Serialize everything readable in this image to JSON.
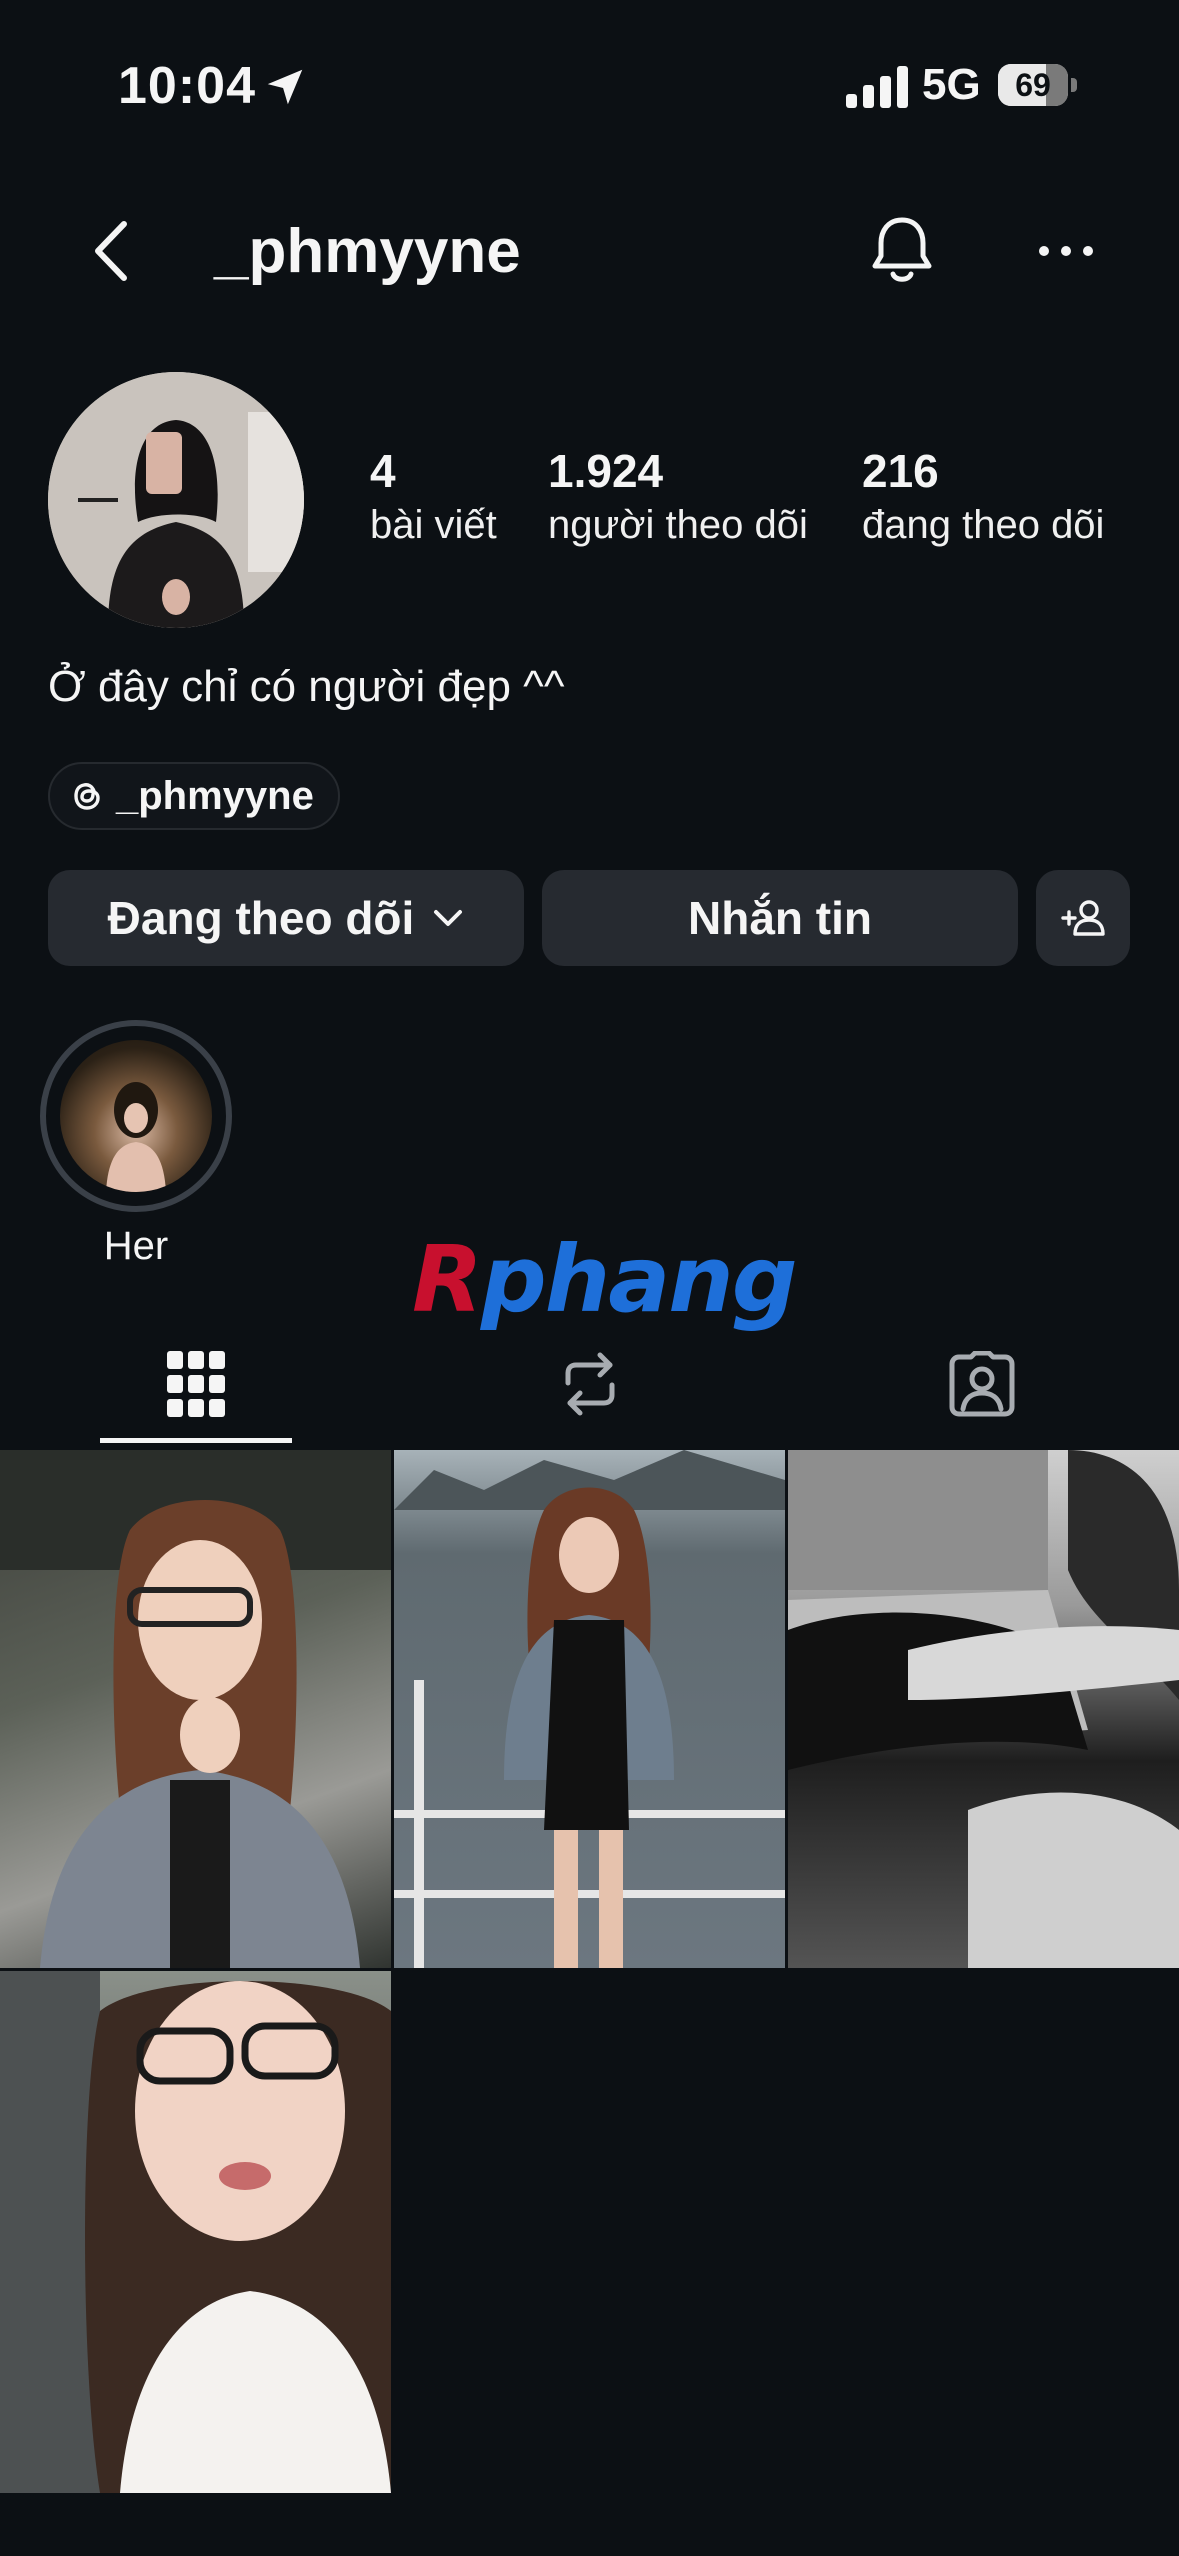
{
  "status_bar": {
    "time": "10:04",
    "network": "5G",
    "battery": "69",
    "battery_level": 0.69
  },
  "header": {
    "username": "_phmyyne"
  },
  "profile": {
    "stats": [
      {
        "value": "4",
        "label": "bài viết"
      },
      {
        "value": "1.924",
        "label": "người theo dõi"
      },
      {
        "value": "216",
        "label": "đang theo dõi"
      }
    ],
    "bio": "Ở đây chỉ có người đẹp ^^",
    "threads_handle": "_phmyyne"
  },
  "actions": {
    "following_label": "Đang theo dõi",
    "message_label": "Nhắn tin"
  },
  "highlights": [
    {
      "label": "Her"
    }
  ],
  "watermark": "Rphang",
  "tabs": [
    "grid-icon",
    "reposts-icon",
    "tagged-icon"
  ],
  "posts": [
    {
      "icon": "photo-woman-gray-jacket-icon"
    },
    {
      "icon": "photo-woman-boat-bay-icon"
    },
    {
      "icon": "photo-black-white-arm-icon"
    },
    {
      "icon": "photo-woman-glasses-car-icon"
    }
  ],
  "colors": {
    "background": "#0c1014",
    "button": "#262a30",
    "text": "#f5f5f5"
  }
}
